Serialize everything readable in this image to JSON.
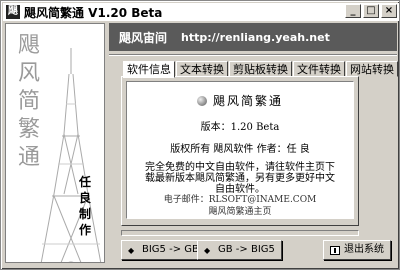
{
  "window": {
    "title": "飓风简繁通 V1.20 Beta",
    "buttons": {
      "minimize": "_",
      "maximize": "□",
      "close": "×"
    }
  },
  "banner": {
    "title": "飓风简繁通",
    "credit": "任良制作"
  },
  "header": {
    "home_label": "飓风宙间",
    "url": "http://renliang.yeah.net"
  },
  "tabs": [
    {
      "label": "软件信息",
      "active": true
    },
    {
      "label": "文本转换",
      "active": false
    },
    {
      "label": "剪贴板转换",
      "active": false
    },
    {
      "label": "文件转换",
      "active": false
    },
    {
      "label": "网站转换",
      "active": false
    }
  ],
  "about": {
    "title": "飓风简繁通",
    "version": "版本：1.20 Beta",
    "copyright": "版权所有 飓风软件   作者：任 良",
    "description": "完全免费的中文自由软件，请往软件主页下载最新版本飓风简繁通，另有更多更好中文自由软件。",
    "email": "电子邮件：RLSOFT@INAME.COM",
    "homepage": "飓风简繁通主页"
  },
  "progress": {
    "value": 0
  },
  "actions": {
    "big5_to_gb": "BIG5 -> GB",
    "gb_to_big5": "GB -> BIG5",
    "exit": "退出系统"
  }
}
